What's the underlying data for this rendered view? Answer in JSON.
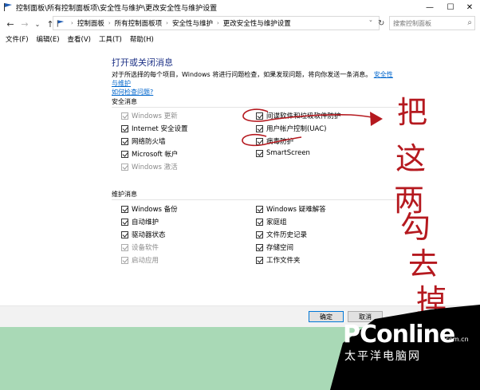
{
  "window": {
    "title": "控制面板\\所有控制面板项\\安全性与维护\\更改安全性与维护设置",
    "min_glyph": "—",
    "max_glyph": "☐",
    "close_glyph": "✕"
  },
  "navigation": {
    "back_glyph": "←",
    "forward_glyph": "→",
    "recent_glyph": "⌄",
    "up_glyph": "↑",
    "breadcrumb": [
      "控制面板",
      "所有控制面板项",
      "安全性与维护",
      "更改安全性与维护设置"
    ],
    "separator_glyph": "›",
    "dropdown_glyph": "⌄",
    "refresh_glyph": "↻",
    "search_placeholder": "搜索控制面板",
    "search_glyph": "⌕"
  },
  "menubar": [
    "文件(F)",
    "编辑(E)",
    "查看(V)",
    "工具(T)",
    "帮助(H)"
  ],
  "page": {
    "title": "打开或关闭消息",
    "description": "对于所选择的每个项目，Windows 将进行问题检查，如果发现问题，将向你发送一条消息。",
    "link1": "安全性与维护",
    "link2": "如何检查问题?"
  },
  "security": {
    "label": "安全消息",
    "left": [
      {
        "label": "Windows 更新",
        "checked": true,
        "enabled": false
      },
      {
        "label": "Internet 安全设置",
        "checked": true,
        "enabled": true
      },
      {
        "label": "网络防火墙",
        "checked": true,
        "enabled": true
      },
      {
        "label": "Microsoft 帐户",
        "checked": true,
        "enabled": true
      },
      {
        "label": "Windows 激活",
        "checked": true,
        "enabled": false
      }
    ],
    "right": [
      {
        "label": "间谍软件和垃圾软件防护",
        "checked": true,
        "enabled": true
      },
      {
        "label": "用户帐户控制(UAC)",
        "checked": true,
        "enabled": true
      },
      {
        "label": "病毒防护",
        "checked": true,
        "enabled": true
      },
      {
        "label": "SmartScreen",
        "checked": true,
        "enabled": true
      }
    ]
  },
  "maintenance": {
    "label": "维护消息",
    "left": [
      {
        "label": "Windows 备份",
        "checked": true,
        "enabled": true
      },
      {
        "label": "自动维护",
        "checked": true,
        "enabled": true
      },
      {
        "label": "驱动器状态",
        "checked": true,
        "enabled": true
      },
      {
        "label": "设备软件",
        "checked": true,
        "enabled": false
      },
      {
        "label": "启动应用",
        "checked": true,
        "enabled": false
      }
    ],
    "right": [
      {
        "label": "Windows 疑难解答",
        "checked": true,
        "enabled": true
      },
      {
        "label": "家庭组",
        "checked": true,
        "enabled": true
      },
      {
        "label": "文件历史记录",
        "checked": true,
        "enabled": true
      },
      {
        "label": "存储空间",
        "checked": true,
        "enabled": true
      },
      {
        "label": "工作文件夹",
        "checked": true,
        "enabled": true
      }
    ]
  },
  "buttons": {
    "ok": "确定",
    "cancel": "取消"
  },
  "annotation": {
    "chars": [
      "把",
      "这",
      "两",
      "勾",
      "去",
      "掉"
    ],
    "color": "#b5191f"
  },
  "watermark": {
    "logo": "PConline",
    "domain": ".com.cn",
    "cn": "太平洋电脑网"
  },
  "colors": {
    "accent": "#0078d7",
    "title_blue": "#1e3287",
    "link": "#0066cc",
    "background_green": "#a9d9b6"
  }
}
